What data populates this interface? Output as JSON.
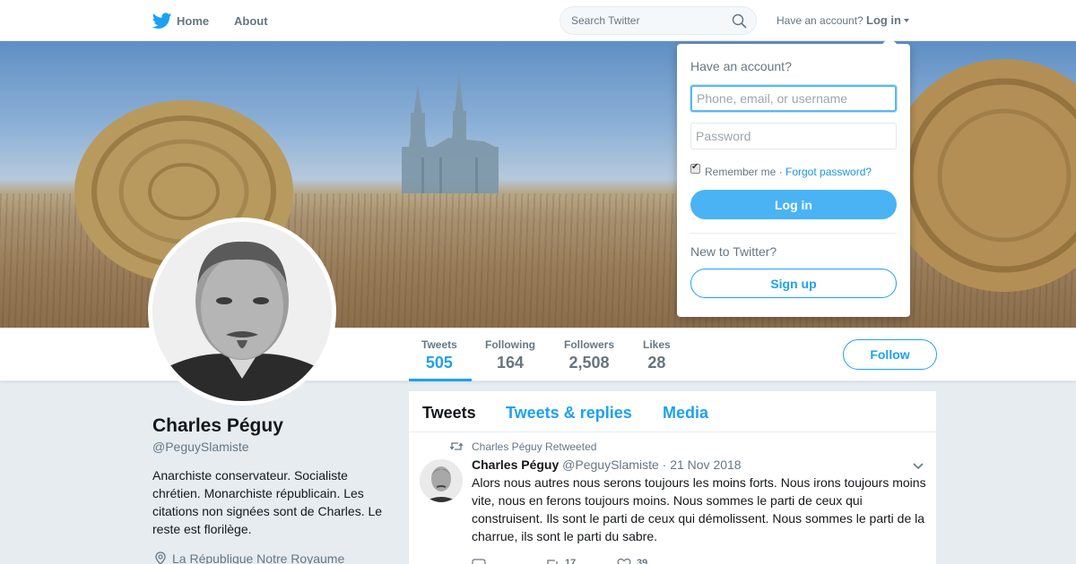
{
  "colors": {
    "accent": "#1da1f2",
    "secondary_text": "#657786",
    "background": "#e6ecf0"
  },
  "topbar": {
    "logo_icon": "twitter-bird-icon",
    "home_label": "Home",
    "about_label": "About",
    "search": {
      "placeholder": "Search Twitter",
      "icon": "search-icon"
    },
    "have_account": "Have an account?",
    "login_label": "Log in"
  },
  "banner": {
    "description_icon": "cathedral-field-hay-bales-photo"
  },
  "stats": {
    "tweets": {
      "label": "Tweets",
      "value": "505"
    },
    "following": {
      "label": "Following",
      "value": "164"
    },
    "followers": {
      "label": "Followers",
      "value": "2,508"
    },
    "likes": {
      "label": "Likes",
      "value": "28"
    }
  },
  "follow_button": "Follow",
  "profile": {
    "name": "Charles Péguy",
    "handle": "@PeguySlamiste",
    "bio": "Anarchiste conservateur. Socialiste chrétien. Monarchiste républicain. Les citations non signées sont de Charles. Le reste est florilège.",
    "location": "La République Notre Royaume"
  },
  "timeline": {
    "tabs": [
      "Tweets",
      "Tweets & replies",
      "Media"
    ],
    "tweet": {
      "context": "Charles Péguy Retweeted",
      "name": "Charles Péguy",
      "handle": "@PeguySlamiste",
      "separator": "·",
      "date": "21 Nov 2018",
      "text": "Alors nous autres nous serons toujours les moins forts. Nous irons toujours moins vite, nous en ferons toujours moins. Nous sommes le parti de ceux qui construisent. Ils sont le parti de ceux qui démolissent. Nous sommes le parti de la charrue, ils sont le parti du sabre.",
      "retweets": "17",
      "likes": "39"
    }
  },
  "login_dropdown": {
    "title": "Have an account?",
    "username_placeholder": "Phone, email, or username",
    "password_placeholder": "Password",
    "remember_me": "Remember me ·",
    "forgot_password": "Forgot password?",
    "login_button": "Log in",
    "new_to_twitter": "New to Twitter?",
    "signup_button": "Sign up"
  }
}
